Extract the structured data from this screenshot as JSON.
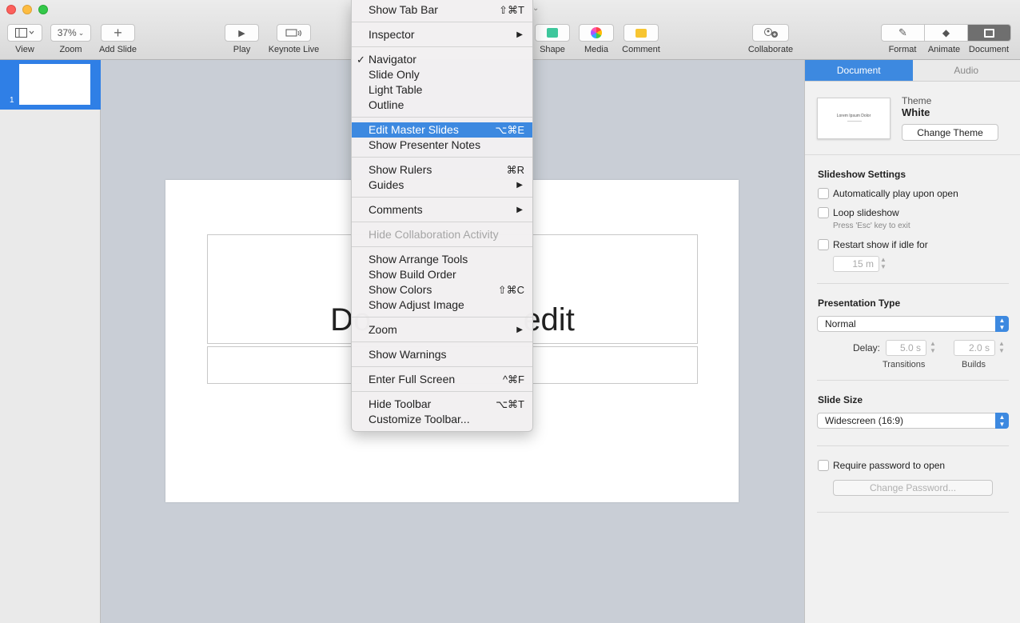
{
  "toolbar": {
    "view_label": "View",
    "zoom_value": "37%",
    "zoom_label": "Zoom",
    "add_slide_label": "Add Slide",
    "play_label": "Play",
    "keynote_live_label": "Keynote Live",
    "shape_label": "Shape",
    "media_label": "Media",
    "comment_label": "Comment",
    "collaborate_label": "Collaborate",
    "format_label": "Format",
    "animate_label": "Animate",
    "document_label": "Document"
  },
  "navigator": {
    "slides": [
      {
        "number": "1"
      }
    ]
  },
  "slide": {
    "title_left": "Do",
    "title_right": "edit"
  },
  "menu": {
    "items": [
      {
        "label": "Show Tab Bar",
        "shortcut": "⇧⌘T"
      },
      {
        "label": "Inspector",
        "submenu": "▶"
      },
      {
        "label": "Navigator",
        "check": "✓"
      },
      {
        "label": "Slide Only"
      },
      {
        "label": "Light Table"
      },
      {
        "label": "Outline"
      },
      {
        "label": "Edit Master Slides",
        "shortcut": "⌥⌘E"
      },
      {
        "label": "Show Presenter Notes"
      },
      {
        "label": "Show Rulers",
        "shortcut": "⌘R"
      },
      {
        "label": "Guides",
        "submenu": "▶"
      },
      {
        "label": "Comments",
        "submenu": "▶"
      },
      {
        "label": "Hide Collaboration Activity"
      },
      {
        "label": "Show Arrange Tools"
      },
      {
        "label": "Show Build Order"
      },
      {
        "label": "Show Colors",
        "shortcut": "⇧⌘C"
      },
      {
        "label": "Show Adjust Image"
      },
      {
        "label": "Zoom",
        "submenu": "▶"
      },
      {
        "label": "Show Warnings"
      },
      {
        "label": "Enter Full Screen",
        "shortcut": "^⌘F"
      },
      {
        "label": "Hide Toolbar",
        "shortcut": "⌥⌘T"
      },
      {
        "label": "Customize Toolbar..."
      }
    ]
  },
  "inspector": {
    "tabs": [
      "Document",
      "Audio"
    ],
    "theme_label": "Theme",
    "theme_name": "White",
    "theme_thumb_text": "Lorem Ipsum Dolor",
    "change_theme": "Change Theme",
    "slideshow_settings": "Slideshow Settings",
    "auto_play": "Automatically play upon open",
    "loop": "Loop slideshow",
    "loop_hint": "Press 'Esc' key to exit",
    "restart": "Restart show if idle for",
    "idle_value": "15 m",
    "presentation_type": "Presentation Type",
    "presentation_value": "Normal",
    "delay_label": "Delay:",
    "transitions_value": "5.0 s",
    "builds_value": "2.0 s",
    "transitions_label": "Transitions",
    "builds_label": "Builds",
    "slide_size": "Slide Size",
    "slide_size_value": "Widescreen (16:9)",
    "require_password": "Require password to open",
    "change_password": "Change Password..."
  },
  "colors": {
    "accent": "#3d89e0",
    "selection": "#2f7fe6"
  }
}
